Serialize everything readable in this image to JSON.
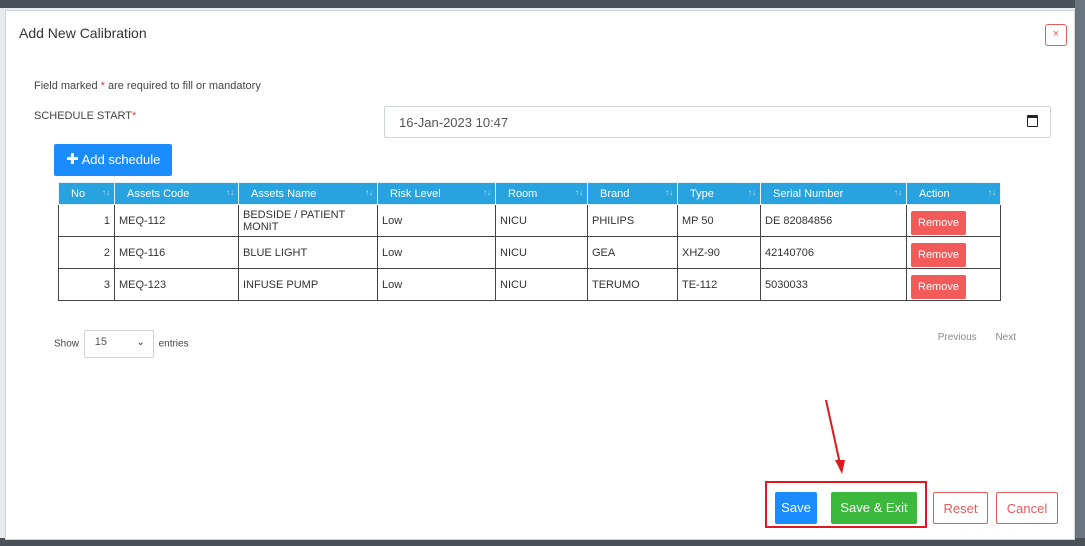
{
  "modal": {
    "title": "Add New Calibration",
    "close_label": "×"
  },
  "form": {
    "required_note_pre": "Field marked ",
    "required_star": "*",
    "required_note_post": " are required to fill or mandatory",
    "schedule_label": "SCHEDULE START",
    "schedule_value": "16-Jan-2023 10:47"
  },
  "add_schedule_label": "Add schedule",
  "table": {
    "headers": [
      "No",
      "Assets Code",
      "Assets Name",
      "Risk Level",
      "Room",
      "Brand",
      "Type",
      "Serial Number",
      "Action"
    ],
    "rows": [
      {
        "no": "1",
        "code": "MEQ-112",
        "name": "BEDSIDE / PATIENT MONIT",
        "risk": "Low",
        "room": "NICU",
        "brand": "PHILIPS",
        "type": "MP 50",
        "serial": "DE 82084856",
        "action": "Remove"
      },
      {
        "no": "2",
        "code": "MEQ-116",
        "name": "BLUE LIGHT",
        "risk": "Low",
        "room": "NICU",
        "brand": "GEA",
        "type": "XHZ-90",
        "serial": "42140706",
        "action": "Remove"
      },
      {
        "no": "3",
        "code": "MEQ-123",
        "name": "INFUSE PUMP",
        "risk": "Low",
        "room": "NICU",
        "brand": "TERUMO",
        "type": "TE-112",
        "serial": "5030033",
        "action": "Remove"
      }
    ]
  },
  "entries": {
    "show_label": "Show",
    "value": "15",
    "entries_label": "entries"
  },
  "pager": {
    "previous": "Previous",
    "next": "Next"
  },
  "footer": {
    "save": "Save",
    "save_exit": "Save & Exit",
    "reset": "Reset",
    "cancel": "Cancel"
  },
  "colors": {
    "header_blue": "#29a3e0",
    "primary": "#1a8cff",
    "success": "#3cb83c",
    "danger": "#f35b5b",
    "highlight": "#e0191f"
  }
}
